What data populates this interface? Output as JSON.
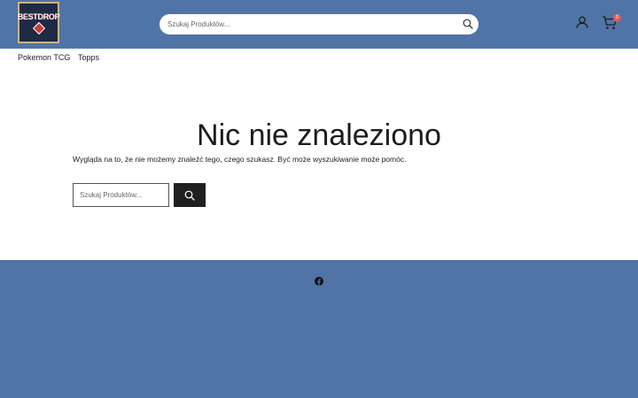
{
  "header": {
    "logo_text": "BESTDROP",
    "search": {
      "placeholder": "Szukaj Produktów..."
    },
    "cart": {
      "count": "0"
    }
  },
  "nav": {
    "items": [
      {
        "label": "Pokemon TCG"
      },
      {
        "label": "Topps"
      }
    ]
  },
  "main": {
    "title": "Nic nie znaleziono",
    "message": "Wygląda na to, że nie możemy znaleźć tego, czego szukasz. Być może wyszukiwanie może pomóc.",
    "search": {
      "placeholder": "Szukaj Produktów..."
    }
  },
  "colors": {
    "header_bg": "#5074a6",
    "footer_bg": "#5074a6",
    "button_bg": "#202020",
    "badge": "#e05a5a"
  },
  "icons": [
    "search-icon",
    "user-icon",
    "cart-icon",
    "facebook-icon"
  ]
}
